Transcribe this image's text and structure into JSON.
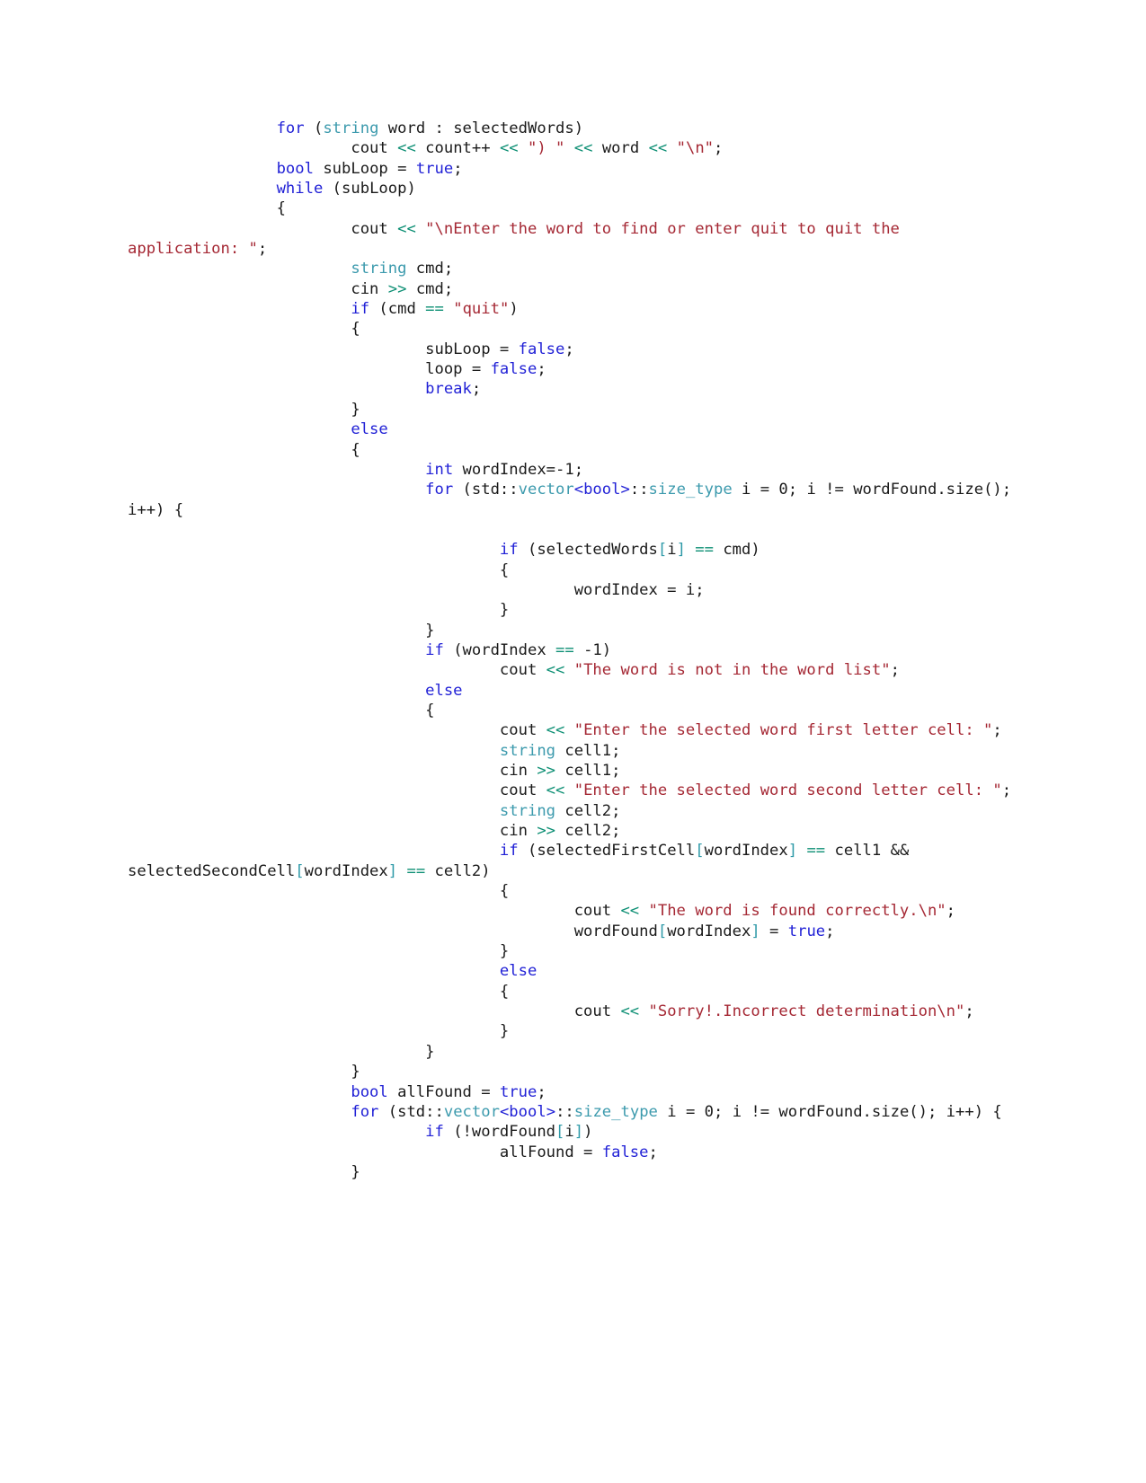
{
  "document": {
    "kind": "code-listing",
    "language": "C++",
    "page_background": "#ffffff",
    "font_size_px": 17,
    "colors": {
      "plain": "#1a1a1a",
      "keyword": "#2121d6",
      "type": "#3c9aad",
      "string": "#a52834",
      "operator": "#0d8f74",
      "bracket": "#2f9aa8"
    }
  },
  "code": {
    "lines": [
      [
        {
          "t": "                ",
          "c": "pl"
        },
        {
          "t": "for",
          "c": "kw"
        },
        {
          "t": " (",
          "c": "pl"
        },
        {
          "t": "string",
          "c": "type"
        },
        {
          "t": " word : selectedWords)",
          "c": "pl"
        }
      ],
      [
        {
          "t": "                        cout ",
          "c": "pl"
        },
        {
          "t": "<<",
          "c": "op"
        },
        {
          "t": " count++ ",
          "c": "pl"
        },
        {
          "t": "<<",
          "c": "op"
        },
        {
          "t": " ",
          "c": "pl"
        },
        {
          "t": "\") \"",
          "c": "str"
        },
        {
          "t": " ",
          "c": "pl"
        },
        {
          "t": "<<",
          "c": "op"
        },
        {
          "t": " word ",
          "c": "pl"
        },
        {
          "t": "<<",
          "c": "op"
        },
        {
          "t": " ",
          "c": "pl"
        },
        {
          "t": "\"\\n\"",
          "c": "str"
        },
        {
          "t": ";",
          "c": "pl"
        }
      ],
      [
        {
          "t": "                ",
          "c": "pl"
        },
        {
          "t": "bool",
          "c": "kw"
        },
        {
          "t": " subLoop = ",
          "c": "pl"
        },
        {
          "t": "true",
          "c": "kw"
        },
        {
          "t": ";",
          "c": "pl"
        }
      ],
      [
        {
          "t": "                ",
          "c": "pl"
        },
        {
          "t": "while",
          "c": "kw"
        },
        {
          "t": " (subLoop)",
          "c": "pl"
        }
      ],
      [
        {
          "t": "                {",
          "c": "pl"
        }
      ],
      [
        {
          "t": "                        cout ",
          "c": "pl"
        },
        {
          "t": "<<",
          "c": "op"
        },
        {
          "t": " ",
          "c": "pl"
        },
        {
          "t": "\"\\nEnter the word to find or enter quit to quit the application: \"",
          "c": "str"
        },
        {
          "t": ";",
          "c": "pl"
        }
      ],
      [
        {
          "t": "                        ",
          "c": "pl"
        },
        {
          "t": "string",
          "c": "type"
        },
        {
          "t": " cmd;",
          "c": "pl"
        }
      ],
      [
        {
          "t": "                        cin ",
          "c": "pl"
        },
        {
          "t": ">>",
          "c": "op"
        },
        {
          "t": " cmd;",
          "c": "pl"
        }
      ],
      [
        {
          "t": "                        ",
          "c": "pl"
        },
        {
          "t": "if",
          "c": "kw"
        },
        {
          "t": " (cmd ",
          "c": "pl"
        },
        {
          "t": "==",
          "c": "op"
        },
        {
          "t": " ",
          "c": "pl"
        },
        {
          "t": "\"quit\"",
          "c": "str"
        },
        {
          "t": ")",
          "c": "pl"
        }
      ],
      [
        {
          "t": "                        {",
          "c": "pl"
        }
      ],
      [
        {
          "t": "                                subLoop = ",
          "c": "pl"
        },
        {
          "t": "false",
          "c": "kw"
        },
        {
          "t": ";",
          "c": "pl"
        }
      ],
      [
        {
          "t": "                                loop = ",
          "c": "pl"
        },
        {
          "t": "false",
          "c": "kw"
        },
        {
          "t": ";",
          "c": "pl"
        }
      ],
      [
        {
          "t": "                                ",
          "c": "pl"
        },
        {
          "t": "break",
          "c": "kw"
        },
        {
          "t": ";",
          "c": "pl"
        }
      ],
      [
        {
          "t": "                        }",
          "c": "pl"
        }
      ],
      [
        {
          "t": "                        ",
          "c": "pl"
        },
        {
          "t": "else",
          "c": "kw"
        }
      ],
      [
        {
          "t": "                        {",
          "c": "pl"
        }
      ],
      [
        {
          "t": "                                ",
          "c": "pl"
        },
        {
          "t": "int",
          "c": "kw"
        },
        {
          "t": " wordIndex=-1;",
          "c": "pl"
        }
      ],
      [
        {
          "t": "                                ",
          "c": "pl"
        },
        {
          "t": "for",
          "c": "kw"
        },
        {
          "t": " (std::",
          "c": "pl"
        },
        {
          "t": "vector",
          "c": "type"
        },
        {
          "t": "<",
          "c": "kw"
        },
        {
          "t": "bool",
          "c": "kw"
        },
        {
          "t": ">",
          "c": "kw"
        },
        {
          "t": "::",
          "c": "pl"
        },
        {
          "t": "size_type",
          "c": "type"
        },
        {
          "t": " i = 0; i != wordFound.size(); i++) {",
          "c": "pl"
        }
      ],
      [
        {
          "t": "",
          "c": "pl"
        }
      ],
      [
        {
          "t": "                                        ",
          "c": "pl"
        },
        {
          "t": "if",
          "c": "kw"
        },
        {
          "t": " (selectedWords",
          "c": "pl"
        },
        {
          "t": "[",
          "c": "brk"
        },
        {
          "t": "i",
          "c": "pl"
        },
        {
          "t": "]",
          "c": "brk"
        },
        {
          "t": " ",
          "c": "pl"
        },
        {
          "t": "==",
          "c": "op"
        },
        {
          "t": " cmd)",
          "c": "pl"
        }
      ],
      [
        {
          "t": "                                        {",
          "c": "pl"
        }
      ],
      [
        {
          "t": "                                                wordIndex = i;",
          "c": "pl"
        }
      ],
      [
        {
          "t": "                                        }",
          "c": "pl"
        }
      ],
      [
        {
          "t": "                                }",
          "c": "pl"
        }
      ],
      [
        {
          "t": "                                ",
          "c": "pl"
        },
        {
          "t": "if",
          "c": "kw"
        },
        {
          "t": " (wordIndex ",
          "c": "pl"
        },
        {
          "t": "==",
          "c": "op"
        },
        {
          "t": " -1)",
          "c": "pl"
        }
      ],
      [
        {
          "t": "                                        cout ",
          "c": "pl"
        },
        {
          "t": "<<",
          "c": "op"
        },
        {
          "t": " ",
          "c": "pl"
        },
        {
          "t": "\"The word is not in the word list\"",
          "c": "str"
        },
        {
          "t": ";",
          "c": "pl"
        }
      ],
      [
        {
          "t": "                                ",
          "c": "pl"
        },
        {
          "t": "else",
          "c": "kw"
        }
      ],
      [
        {
          "t": "                                {",
          "c": "pl"
        }
      ],
      [
        {
          "t": "                                        cout ",
          "c": "pl"
        },
        {
          "t": "<<",
          "c": "op"
        },
        {
          "t": " ",
          "c": "pl"
        },
        {
          "t": "\"Enter the selected word first letter cell: \"",
          "c": "str"
        },
        {
          "t": ";",
          "c": "pl"
        }
      ],
      [
        {
          "t": "                                        ",
          "c": "pl"
        },
        {
          "t": "string",
          "c": "type"
        },
        {
          "t": " cell1;",
          "c": "pl"
        }
      ],
      [
        {
          "t": "                                        cin ",
          "c": "pl"
        },
        {
          "t": ">>",
          "c": "op"
        },
        {
          "t": " cell1;",
          "c": "pl"
        }
      ],
      [
        {
          "t": "                                        cout ",
          "c": "pl"
        },
        {
          "t": "<<",
          "c": "op"
        },
        {
          "t": " ",
          "c": "pl"
        },
        {
          "t": "\"Enter the selected word second letter cell: \"",
          "c": "str"
        },
        {
          "t": ";",
          "c": "pl"
        }
      ],
      [
        {
          "t": "                                        ",
          "c": "pl"
        },
        {
          "t": "string",
          "c": "type"
        },
        {
          "t": " cell2;",
          "c": "pl"
        }
      ],
      [
        {
          "t": "                                        cin ",
          "c": "pl"
        },
        {
          "t": ">>",
          "c": "op"
        },
        {
          "t": " cell2;",
          "c": "pl"
        }
      ],
      [
        {
          "t": "                                        ",
          "c": "pl"
        },
        {
          "t": "if",
          "c": "kw"
        },
        {
          "t": " (selectedFirstCell",
          "c": "pl"
        },
        {
          "t": "[",
          "c": "brk"
        },
        {
          "t": "wordIndex",
          "c": "pl"
        },
        {
          "t": "]",
          "c": "brk"
        },
        {
          "t": " ",
          "c": "pl"
        },
        {
          "t": "==",
          "c": "op"
        },
        {
          "t": " cell1 && selectedSecondCell",
          "c": "pl"
        },
        {
          "t": "[",
          "c": "brk"
        },
        {
          "t": "wordIndex",
          "c": "pl"
        },
        {
          "t": "]",
          "c": "brk"
        },
        {
          "t": " ",
          "c": "pl"
        },
        {
          "t": "==",
          "c": "op"
        },
        {
          "t": " cell2)",
          "c": "pl"
        }
      ],
      [
        {
          "t": "                                        {",
          "c": "pl"
        }
      ],
      [
        {
          "t": "                                                cout ",
          "c": "pl"
        },
        {
          "t": "<<",
          "c": "op"
        },
        {
          "t": " ",
          "c": "pl"
        },
        {
          "t": "\"The word is found correctly.\\n\"",
          "c": "str"
        },
        {
          "t": ";",
          "c": "pl"
        }
      ],
      [
        {
          "t": "                                                wordFound",
          "c": "pl"
        },
        {
          "t": "[",
          "c": "brk"
        },
        {
          "t": "wordIndex",
          "c": "pl"
        },
        {
          "t": "]",
          "c": "brk"
        },
        {
          "t": " = ",
          "c": "pl"
        },
        {
          "t": "true",
          "c": "kw"
        },
        {
          "t": ";",
          "c": "pl"
        }
      ],
      [
        {
          "t": "                                        }",
          "c": "pl"
        }
      ],
      [
        {
          "t": "                                        ",
          "c": "pl"
        },
        {
          "t": "else",
          "c": "kw"
        }
      ],
      [
        {
          "t": "                                        {",
          "c": "pl"
        }
      ],
      [
        {
          "t": "                                                cout ",
          "c": "pl"
        },
        {
          "t": "<<",
          "c": "op"
        },
        {
          "t": " ",
          "c": "pl"
        },
        {
          "t": "\"Sorry!.Incorrect determination\\n\"",
          "c": "str"
        },
        {
          "t": ";",
          "c": "pl"
        }
      ],
      [
        {
          "t": "                                        }",
          "c": "pl"
        }
      ],
      [
        {
          "t": "                                }",
          "c": "pl"
        }
      ],
      [
        {
          "t": "                        }",
          "c": "pl"
        }
      ],
      [
        {
          "t": "                        ",
          "c": "pl"
        },
        {
          "t": "bool",
          "c": "kw"
        },
        {
          "t": " allFound = ",
          "c": "pl"
        },
        {
          "t": "true",
          "c": "kw"
        },
        {
          "t": ";",
          "c": "pl"
        }
      ],
      [
        {
          "t": "                        ",
          "c": "pl"
        },
        {
          "t": "for",
          "c": "kw"
        },
        {
          "t": " (std::",
          "c": "pl"
        },
        {
          "t": "vector",
          "c": "type"
        },
        {
          "t": "<",
          "c": "kw"
        },
        {
          "t": "bool",
          "c": "kw"
        },
        {
          "t": ">",
          "c": "kw"
        },
        {
          "t": "::",
          "c": "pl"
        },
        {
          "t": "size_type",
          "c": "type"
        },
        {
          "t": " i = 0; i != wordFound.size(); i++) {",
          "c": "pl"
        }
      ],
      [
        {
          "t": "                                ",
          "c": "pl"
        },
        {
          "t": "if",
          "c": "kw"
        },
        {
          "t": " (!wordFound",
          "c": "pl"
        },
        {
          "t": "[",
          "c": "brk"
        },
        {
          "t": "i",
          "c": "pl"
        },
        {
          "t": "]",
          "c": "brk"
        },
        {
          "t": ")",
          "c": "pl"
        }
      ],
      [
        {
          "t": "                                        allFound = ",
          "c": "pl"
        },
        {
          "t": "false",
          "c": "kw"
        },
        {
          "t": ";",
          "c": "pl"
        }
      ],
      [
        {
          "t": "                        }",
          "c": "pl"
        }
      ]
    ]
  }
}
